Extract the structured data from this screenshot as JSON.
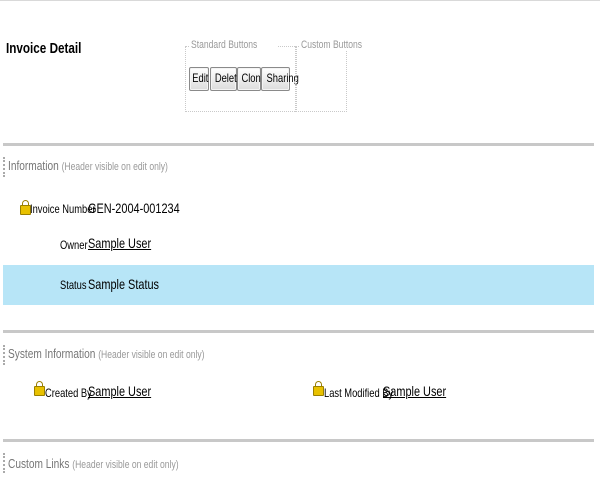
{
  "header": {
    "title": "Invoice Detail",
    "standard_buttons_label": "Standard Buttons",
    "custom_buttons_label": "Custom Buttons",
    "buttons": [
      "Edit",
      "Delete",
      "Clone",
      "Sharing"
    ]
  },
  "information": {
    "title": "Information",
    "note": "(Header visible on edit only)",
    "invoice_number_label": "Invoice Number",
    "invoice_number_value": "GEN-2004-001234",
    "owner_label": "Owner",
    "owner_value": "Sample User",
    "status_label": "Status",
    "status_value": "Sample Status"
  },
  "system_information": {
    "title": "System Information",
    "note": "(Header visible on edit only)",
    "created_by_label": "Created By",
    "created_by_value": "Sample User",
    "last_modified_label": "Last Modified By",
    "last_modified_value": "Sample User"
  },
  "custom_links": {
    "title": "Custom Links",
    "note": "(Header visible on edit only)"
  },
  "colors": {
    "status_highlight": "#b7e5f7",
    "lock_icon": "#e8c100",
    "separator": "#c8c8c8"
  }
}
